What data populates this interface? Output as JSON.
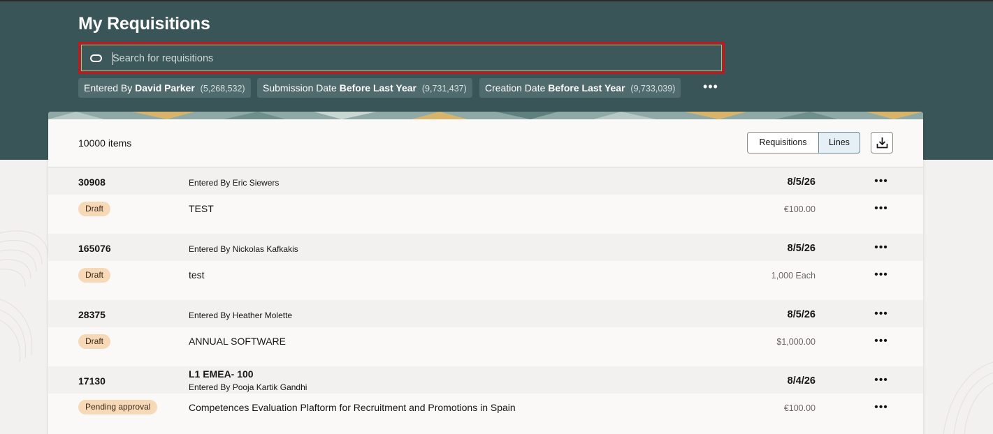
{
  "header": {
    "title": "My Requisitions"
  },
  "search": {
    "placeholder": "Search for requisitions",
    "icon": "search-icon"
  },
  "filters": [
    {
      "label": "Entered By",
      "value": "David Parker",
      "count": "(5,268,532)"
    },
    {
      "label": "Submission Date",
      "value": "Before Last Year",
      "count": "(9,731,437)"
    },
    {
      "label": "Creation Date",
      "value": "Before Last Year",
      "count": "(9,733,039)"
    }
  ],
  "more_filters_label": "•••",
  "results": {
    "count_label": "10000 items",
    "view_toggle": {
      "options": [
        "Requisitions",
        "Lines"
      ],
      "selected": "Lines"
    },
    "download_icon": "download-icon"
  },
  "rows": [
    {
      "number": "30908",
      "title": "",
      "entered_by": "Entered By Eric Siewers",
      "date": "8/5/26",
      "status": "Draft",
      "line_description": "TEST",
      "line_amount": "€100.00"
    },
    {
      "number": "165076",
      "title": "",
      "entered_by": "Entered By Nickolas Kafkakis",
      "date": "8/5/26",
      "status": "Draft",
      "line_description": "test",
      "line_amount": "1,000 Each"
    },
    {
      "number": "28375",
      "title": "",
      "entered_by": "Entered By Heather Molette",
      "date": "8/5/26",
      "status": "Draft",
      "line_description": "ANNUAL SOFTWARE",
      "line_amount": "$1,000.00"
    },
    {
      "number": "17130",
      "title": "L1 EMEA- 100",
      "entered_by": "Entered By Pooja Kartik Gandhi",
      "date": "8/4/26",
      "status": "Pending approval",
      "line_description": "Competences Evaluation Plaftorm for Recruitment and Promotions in Spain",
      "line_amount": "€100.00"
    }
  ],
  "row_menu_label": "•••",
  "colors": {
    "header_bg": "#395558",
    "search_highlight": "#c4161c",
    "status_badge_bg": "#f7d9b8",
    "selected_toggle_bg": "#e4f0f6"
  }
}
